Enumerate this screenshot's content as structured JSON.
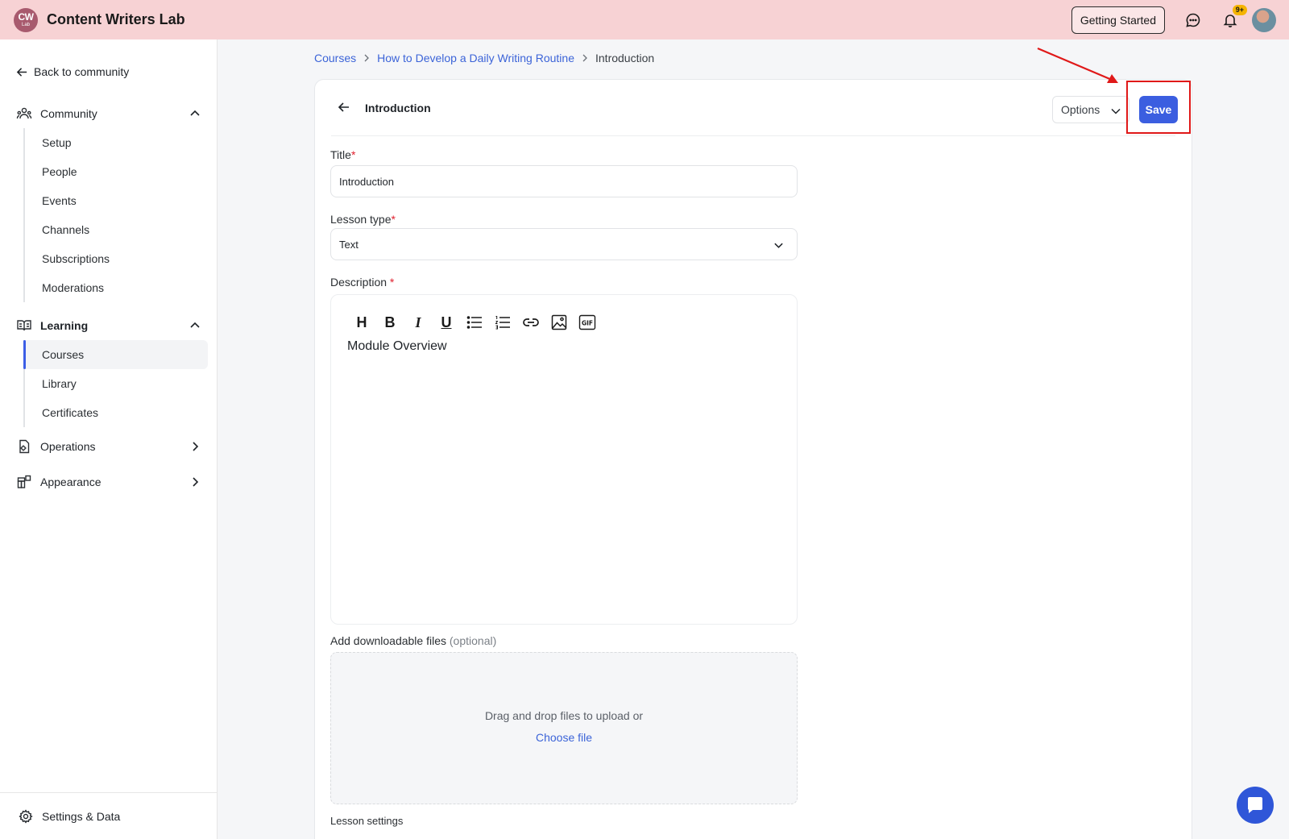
{
  "app": {
    "logo_top": "CW",
    "logo_bottom": "Lab",
    "brand": "Content Writers Lab"
  },
  "topbar": {
    "getting_started": "Getting Started",
    "notif_badge": "9+"
  },
  "sidebar": {
    "back": "Back to community",
    "community": {
      "label": "Community",
      "items": [
        "Setup",
        "People",
        "Events",
        "Channels",
        "Subscriptions",
        "Moderations"
      ]
    },
    "learning": {
      "label": "Learning",
      "items": [
        "Courses",
        "Library",
        "Certificates"
      ],
      "active": "Courses"
    },
    "operations": "Operations",
    "appearance": "Appearance",
    "settings": "Settings & Data"
  },
  "breadcrumb": {
    "c1": "Courses",
    "c2": "How to Develop a Daily Writing Routine",
    "c3": "Introduction"
  },
  "editor_header": {
    "title": "Introduction",
    "options": "Options",
    "save": "Save"
  },
  "form": {
    "title_label": "Title",
    "title_value": "Introduction",
    "lesson_type_label": "Lesson type",
    "lesson_type_value": "Text",
    "description_label": "Description",
    "description_text": "Module Overview",
    "required_mark": "*",
    "files_label": "Add downloadable files",
    "files_optional": "(optional)",
    "dropzone_text": "Drag and drop files to upload or",
    "choose_file": "Choose file",
    "lesson_settings": "Lesson settings"
  },
  "colors": {
    "topbar": "#f7d2d4",
    "accent": "#3b5ee0",
    "annotation": "#e01919"
  }
}
